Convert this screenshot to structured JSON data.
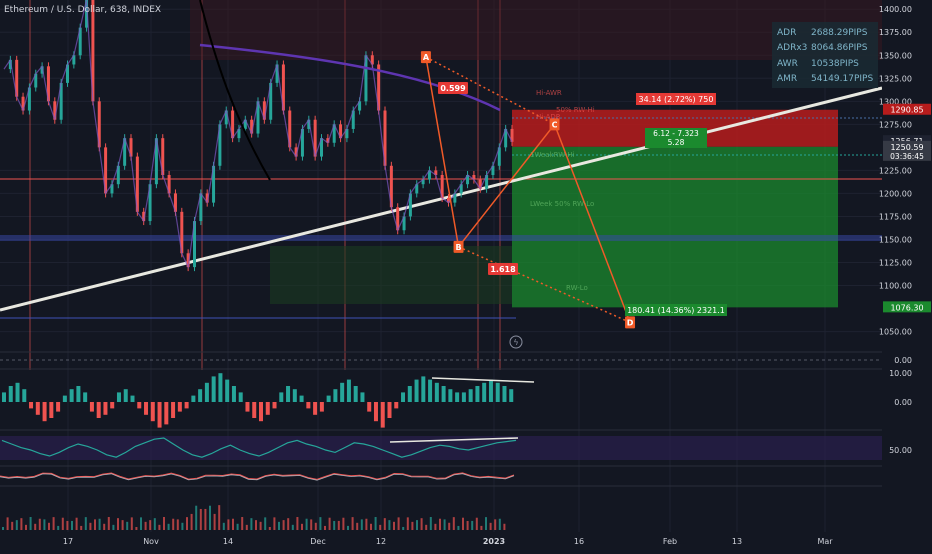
{
  "header": {
    "title": "Ethereum / U.S. Dollar, 638, INDEX"
  },
  "stats": [
    {
      "label": "ADR",
      "value": "2688.29PIPS"
    },
    {
      "label": "ADRx3",
      "value": "8064.86PIPS"
    },
    {
      "label": "AWR",
      "value": "10538PIPS"
    },
    {
      "label": "AMR",
      "value": "54149.17PIPS"
    }
  ],
  "colors": {
    "background": "#131722",
    "grid": "#1e2230",
    "up": "#26a69a",
    "down": "#ef5350",
    "pattern": "#f05a28",
    "trendline": "#e8e8e0",
    "target_zone": "#1b8a2e",
    "stop_zone": "#b71c1c",
    "axis_text": "#d1d4dc",
    "stats_bg": "#1a2a33",
    "stats_text": "#7fb5c9"
  },
  "chart_data": [
    {
      "type": "line",
      "pane": "price",
      "x_tick_labels": [
        "17",
        "Nov",
        "14",
        "Dec",
        "12",
        "2023",
        "16",
        "Feb",
        "13",
        "Mar"
      ],
      "y_tick_labels": [
        "1400.00",
        "1375.00",
        "1350.00",
        "1325.00",
        "1300.00",
        "1275.00",
        "1225.00",
        "1200.00",
        "1175.00",
        "1150.00",
        "1125.00",
        "1100.00",
        "1050.00"
      ],
      "ylim": [
        1030,
        1410
      ],
      "price_tags": [
        {
          "value": 1290.85,
          "label": "1290.85",
          "color": "#b71c1c"
        },
        {
          "value": 1256.71,
          "label": "1256.71",
          "color": "#1e2230"
        },
        {
          "value": 1250.59,
          "label": "1250.59",
          "sublabel": "03:36:45",
          "color": "#363a45"
        },
        {
          "value": 1076.3,
          "label": "1076.30",
          "color": "#1b8a2e"
        }
      ],
      "series": [
        {
          "values": [
            1335,
            1345,
            1305,
            1290,
            1315,
            1330,
            1338,
            1300,
            1280,
            1320,
            1340,
            1350,
            1380,
            1410,
            1300,
            1250,
            1200,
            1210,
            1230,
            1260,
            1240,
            1180,
            1170,
            1210,
            1260,
            1220,
            1200,
            1180,
            1135,
            1120,
            1170,
            1200,
            1190,
            1230,
            1275,
            1290,
            1260,
            1270,
            1280,
            1265,
            1300,
            1280,
            1320,
            1340,
            1290,
            1250,
            1240,
            1270,
            1280,
            1240,
            1260,
            1255,
            1275,
            1260,
            1270,
            1290,
            1300,
            1350,
            1340,
            1290,
            1230,
            1185,
            1160,
            1175,
            1200,
            1210,
            1215,
            1225,
            1220,
            1195,
            1190,
            1200,
            1210,
            1220,
            1215,
            1205,
            1220,
            1230,
            1250,
            1270,
            1256
          ]
        }
      ],
      "harmonic_pattern": [
        {
          "point": "A",
          "x": 0.457,
          "value": 1348
        },
        {
          "point": "B",
          "x": 0.492,
          "value": 1142
        },
        {
          "point": "C",
          "x": 0.595,
          "value": 1275
        },
        {
          "point": "D",
          "x": 0.676,
          "value": 1060
        }
      ],
      "ratios": [
        "0.599",
        "1.618"
      ],
      "position": {
        "entry": 1250.59,
        "stop": 1290.85,
        "target": 1076.3,
        "stop_label": "34.14 (2.72%) 750",
        "target_label": "180.41 (14.36%) 2321.1",
        "rr_label_line1": "6.12 - 7.323",
        "rr_label_line2": "5.28"
      },
      "level_labels": [
        "Hi-AWR",
        "50% RW-Hi",
        "Hi-ADR",
        "1WeakRW-Hi",
        "LWeek 50% RW-Lo",
        "RW-Lo"
      ]
    },
    {
      "type": "line",
      "pane": "indicator-1",
      "y_tick_labels": [
        "0.00"
      ]
    },
    {
      "type": "bar",
      "pane": "oscillator-histogram",
      "y_tick_labels": [
        "10.00",
        "0.00"
      ],
      "values": [
        3,
        5,
        6,
        4,
        -2,
        -4,
        -6,
        -5,
        -3,
        2,
        4,
        5,
        3,
        -3,
        -5,
        -4,
        -2,
        3,
        4,
        2,
        -2,
        -4,
        -6,
        -8,
        -7,
        -5,
        -3,
        -2,
        2,
        4,
        6,
        8,
        9,
        7,
        5,
        3,
        -3,
        -5,
        -6,
        -4,
        -2,
        3,
        5,
        4,
        2,
        -2,
        -4,
        -3,
        2,
        4,
        6,
        7,
        5,
        3,
        -3,
        -6,
        -8,
        -5,
        -2,
        3,
        5,
        7,
        8,
        7,
        6,
        5,
        4,
        3,
        3,
        4,
        5,
        6,
        7,
        6,
        5,
        4
      ]
    },
    {
      "type": "line",
      "pane": "rsi",
      "y_tick_labels": [
        "50.00"
      ],
      "values": [
        58,
        55,
        52,
        50,
        47,
        45,
        48,
        52,
        55,
        53,
        50,
        46,
        44,
        48,
        53,
        56,
        59,
        60,
        55,
        50,
        46,
        44,
        47,
        51,
        54,
        50,
        47,
        45,
        48,
        52,
        56,
        58,
        55,
        53,
        50,
        48,
        52,
        56,
        55,
        53,
        50,
        47,
        44,
        46,
        49,
        52,
        54,
        53,
        51,
        50,
        52,
        54,
        56,
        57,
        58
      ]
    },
    {
      "type": "line",
      "pane": "momentum",
      "y_tick_labels": []
    },
    {
      "type": "bar",
      "pane": "volume",
      "y_tick_labels": []
    }
  ]
}
